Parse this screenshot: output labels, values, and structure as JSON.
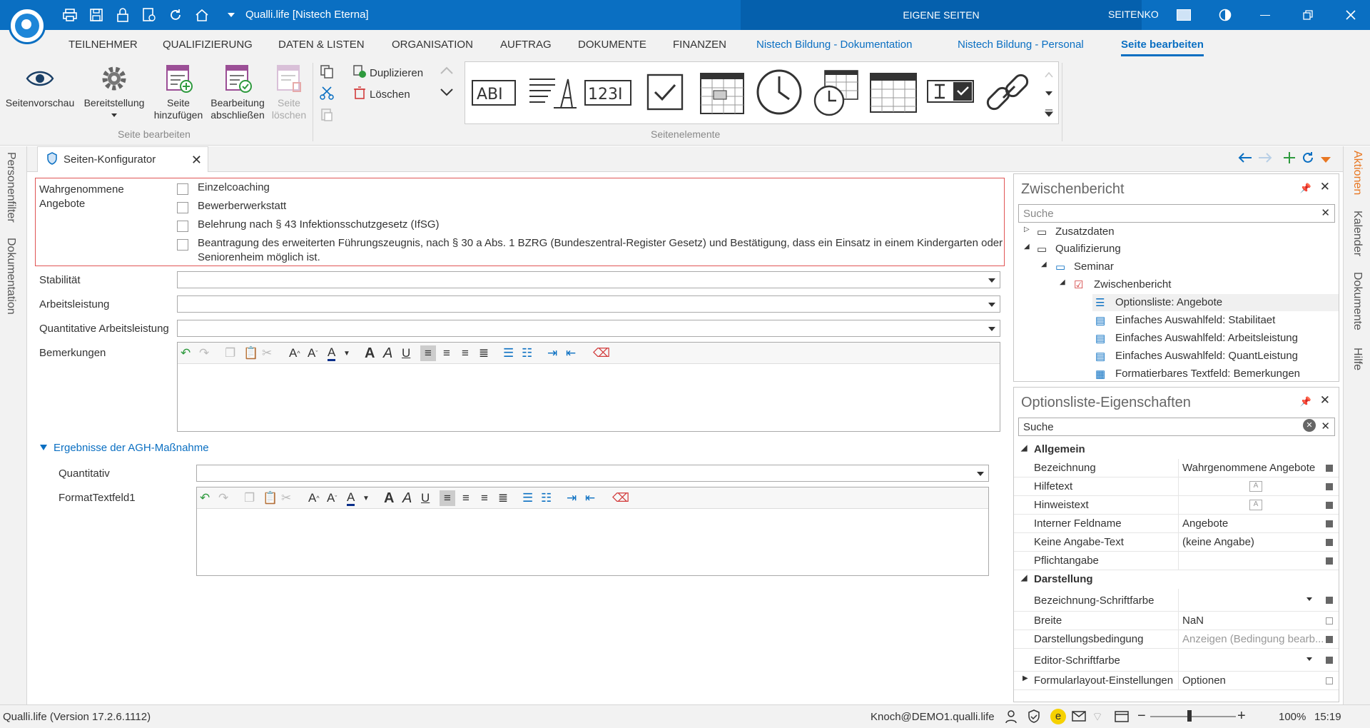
{
  "window": {
    "title": "Qualli.life [Nistech Eterna]",
    "eigene": "EIGENE SEITEN",
    "seitenk": "SEITENKONFIGURATOR"
  },
  "menu": [
    "TEILNEHMER",
    "QUALIFIZIERUNG",
    "DATEN & LISTEN",
    "ORGANISATION",
    "AUFTRAG",
    "DOKUMENTE",
    "FINANZEN",
    "Nistech Bildung - Dokumentation",
    "Nistech Bildung - Personal",
    "Seite bearbeiten"
  ],
  "ribbon": {
    "seitenvorschau": "Seitenvorschau",
    "bereitstellung": "Bereitstellung",
    "seite": "Seite",
    "hinzufuegen": "hinzufügen",
    "bearbeitung": "Bearbeitung",
    "abschliessen": "abschließen",
    "loeschen1": "Seite",
    "loeschen2": "löschen",
    "group1": "Seite bearbeiten",
    "duplizieren": "Duplizieren",
    "loeschen": "Löschen",
    "group2": "Seitenelemente",
    "gallery": [
      "ABI",
      "text-format-icon",
      "123I",
      "checkbox-icon",
      "date-icon",
      "clock-icon",
      "datetime-icon",
      "table-icon",
      "textcheck-icon",
      "link-icon"
    ]
  },
  "left_strip": [
    "Personenfilter",
    "Dokumentation"
  ],
  "right_strip": [
    "Aktionen",
    "Kalender",
    "Dokumente",
    "Hilfe"
  ],
  "tab": {
    "label": "Seiten-Konfigurator"
  },
  "form": {
    "angebote_label1": "Wahrgenommene",
    "angebote_label2": "Angebote",
    "options": [
      "Einzelcoaching",
      "Bewerberwerkstatt",
      "Belehrung nach § 43 Infektionsschutzgesetz (IfSG)",
      "Beantragung des erweiterten Führungszeugnis, nach § 30 a Abs. 1 BZRG (Bundeszentral-Register Gesetz) und Bestätigung, dass ein Einsatz in einem Kindergarten oder",
      "Seniorenheim möglich ist."
    ],
    "stabilitaet": "Stabilität",
    "arbeitsleistung": "Arbeitsleistung",
    "quantitative": "Quantitative Arbeitsleistung",
    "bemerkungen": "Bemerkungen",
    "section": "Ergebnisse der AGH-Maßnahme",
    "quantitativ": "Quantitativ",
    "formattextfeld": "FormatTextfeld1"
  },
  "zwischen": {
    "title": "Zwischenbericht",
    "search": "Suche",
    "nodes": [
      "Zusatzdaten",
      "Qualifizierung",
      "Seminar",
      "Zwischenbericht",
      "Optionsliste: Angebote",
      "Einfaches Auswahlfeld: Stabilitaet",
      "Einfaches Auswahlfeld: Arbeitsleistung",
      "Einfaches Auswahlfeld: QuantLeistung",
      "Formatierbares Textfeld: Bemerkungen"
    ]
  },
  "props": {
    "title": "Optionsliste-Eigenschaften",
    "search": "Suche",
    "cat1": "Allgemein",
    "cat2": "Darstellung",
    "rows1": [
      {
        "k": "Bezeichnung",
        "v": "Wahrgenommene Angebote"
      },
      {
        "k": "Hilfetext",
        "v": ""
      },
      {
        "k": "Hinweistext",
        "v": ""
      },
      {
        "k": "Interner Feldname",
        "v": "Angebote"
      },
      {
        "k": "Keine Angabe-Text",
        "v": "(keine Angabe)"
      },
      {
        "k": "Pflichtangabe",
        "v": ""
      }
    ],
    "rows2": [
      {
        "k": "Bezeichnung-Schriftfarbe",
        "v": ""
      },
      {
        "k": "Breite",
        "v": "NaN"
      },
      {
        "k": "Darstellungsbedingung",
        "v": "Anzeigen (Bedingung bearb..."
      },
      {
        "k": "Editor-Schriftfarbe",
        "v": ""
      },
      {
        "k": "Formularlayout-Einstellungen",
        "v": "Optionen"
      }
    ]
  },
  "status": {
    "version": "Qualli.life (Version 17.2.6.1112)",
    "user": "Knoch@DEMO1.qualli.life",
    "zoom": "100%",
    "time": "15:19"
  },
  "colors": {
    "accent": "#0a6fc2",
    "danger": "#e05555",
    "orange": "#e87722"
  }
}
